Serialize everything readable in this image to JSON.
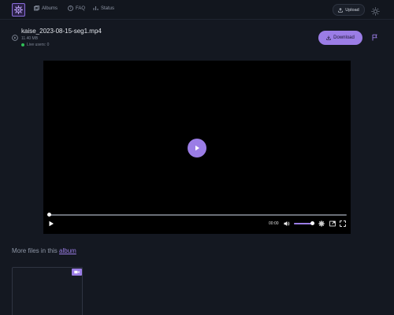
{
  "header": {
    "logo_icon": "gear-logo-icon",
    "nav": [
      {
        "label": "Albums",
        "icon": "albums-icon"
      },
      {
        "label": "FAQ",
        "icon": "question-icon"
      },
      {
        "label": "Status",
        "icon": "chart-icon"
      }
    ],
    "upload_label": "Upload",
    "theme_icon": "sun-icon"
  },
  "file": {
    "name": "kaise_2023-08-15-seg1.mp4",
    "size": "11.40 MB",
    "live_users": "Live users: 0",
    "download_label": "Download"
  },
  "player": {
    "time": "00:00",
    "progress": 0,
    "volume": 1.0
  },
  "more": {
    "prefix": "More files in this",
    "link": "album"
  },
  "colors": {
    "accent": "#9b7de6",
    "background": "#141821",
    "live": "#2fbf57"
  }
}
